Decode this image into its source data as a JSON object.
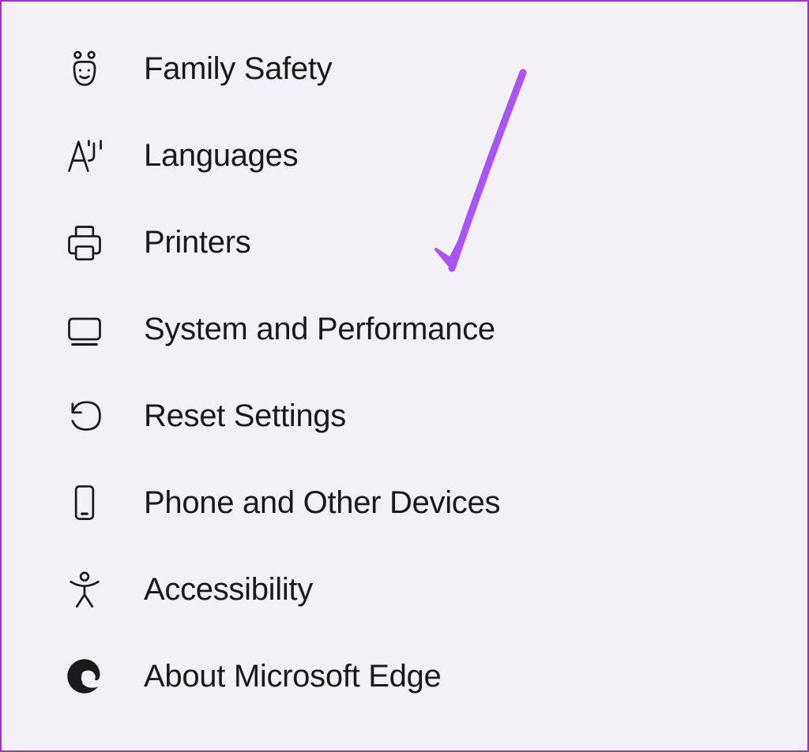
{
  "menu": {
    "items": [
      {
        "label": "Family Safety",
        "icon": "family-safety"
      },
      {
        "label": "Languages",
        "icon": "languages"
      },
      {
        "label": "Printers",
        "icon": "printers"
      },
      {
        "label": "System and Performance",
        "icon": "system"
      },
      {
        "label": "Reset Settings",
        "icon": "reset"
      },
      {
        "label": "Phone and Other Devices",
        "icon": "phone"
      },
      {
        "label": "Accessibility",
        "icon": "accessibility"
      },
      {
        "label": "About Microsoft Edge",
        "icon": "edge"
      }
    ]
  },
  "annotation": {
    "arrow_target": "System and Performance",
    "arrow_color": "#a855f7"
  }
}
